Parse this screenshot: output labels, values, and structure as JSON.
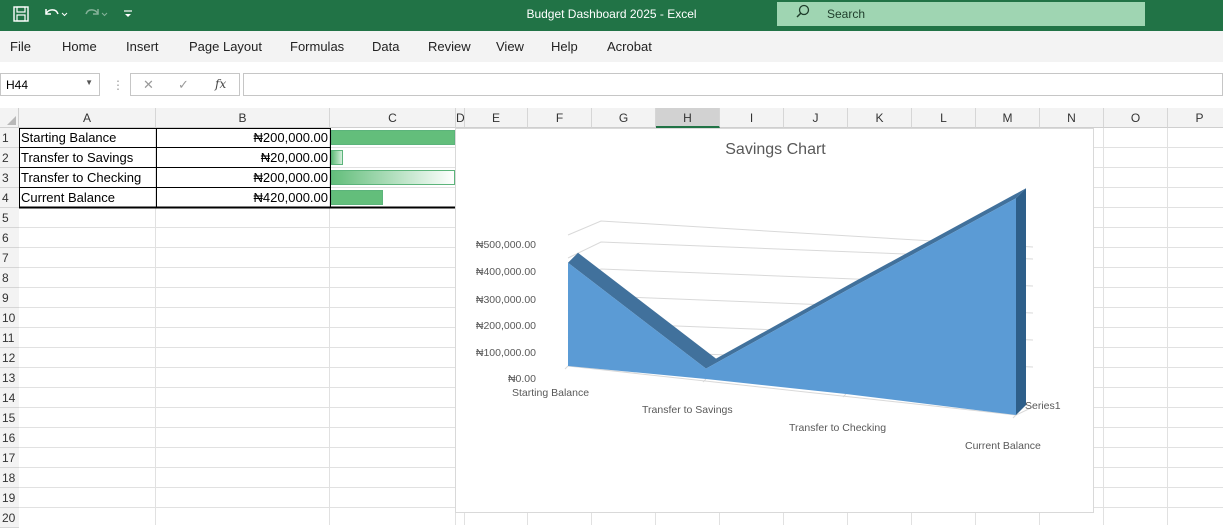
{
  "app": {
    "title": "Budget Dashboard 2025  -  Excel",
    "search_placeholder": "Search",
    "qat_icons": [
      "save-icon",
      "undo-icon",
      "redo-icon",
      "customize-icon"
    ]
  },
  "ribbon": {
    "tabs": [
      "File",
      "Home",
      "Insert",
      "Page Layout",
      "Formulas",
      "Data",
      "Review",
      "View",
      "Help",
      "Acrobat"
    ]
  },
  "formula_bar": {
    "name_box": "H44",
    "formula": "",
    "cancel_glyph": "✕",
    "enter_glyph": "✓",
    "fx_glyph": "fx"
  },
  "sheet": {
    "columns": [
      "A",
      "B",
      "C",
      "D",
      "E",
      "F",
      "G",
      "H",
      "I",
      "J",
      "K",
      "L",
      "M",
      "N",
      "O",
      "P"
    ],
    "selected_column": "H",
    "rows": [
      "1",
      "2",
      "3",
      "4",
      "5",
      "6",
      "7",
      "8",
      "9",
      "10",
      "11",
      "12",
      "13",
      "14",
      "15",
      "16",
      "17",
      "18",
      "19",
      "20"
    ],
    "data": [
      {
        "label": "Starting Balance",
        "value": "₦200,000.00",
        "databar": 1.0
      },
      {
        "label": "Transfer to Savings",
        "value": "₦20,000.00",
        "databar": 0.1
      },
      {
        "label": "Transfer to Checking",
        "value": "₦200,000.00",
        "databar": 1.0
      },
      {
        "label": "Current Balance",
        "value": "₦420,000.00",
        "databar": 0.42
      }
    ]
  },
  "chart": {
    "title": "Savings Chart",
    "y_ticks": [
      "₦0.00",
      "₦100,000.00",
      "₦200,000.00",
      "₦300,000.00",
      "₦400,000.00",
      "₦500,000.00"
    ],
    "series_name": "Series1",
    "colors": {
      "front": "#5b9bd5",
      "top": "#41719c",
      "side": "#2e5f8a"
    }
  },
  "chart_data": {
    "type": "area",
    "title": "Savings Chart",
    "categories": [
      "Starting Balance",
      "Transfer to Savings",
      "Transfer to Checking",
      "Current Balance"
    ],
    "series": [
      {
        "name": "Series1",
        "values": [
          200000,
          20000,
          200000,
          420000
        ]
      }
    ],
    "ylim": [
      0,
      500000
    ],
    "grid": true,
    "three_d": true
  }
}
